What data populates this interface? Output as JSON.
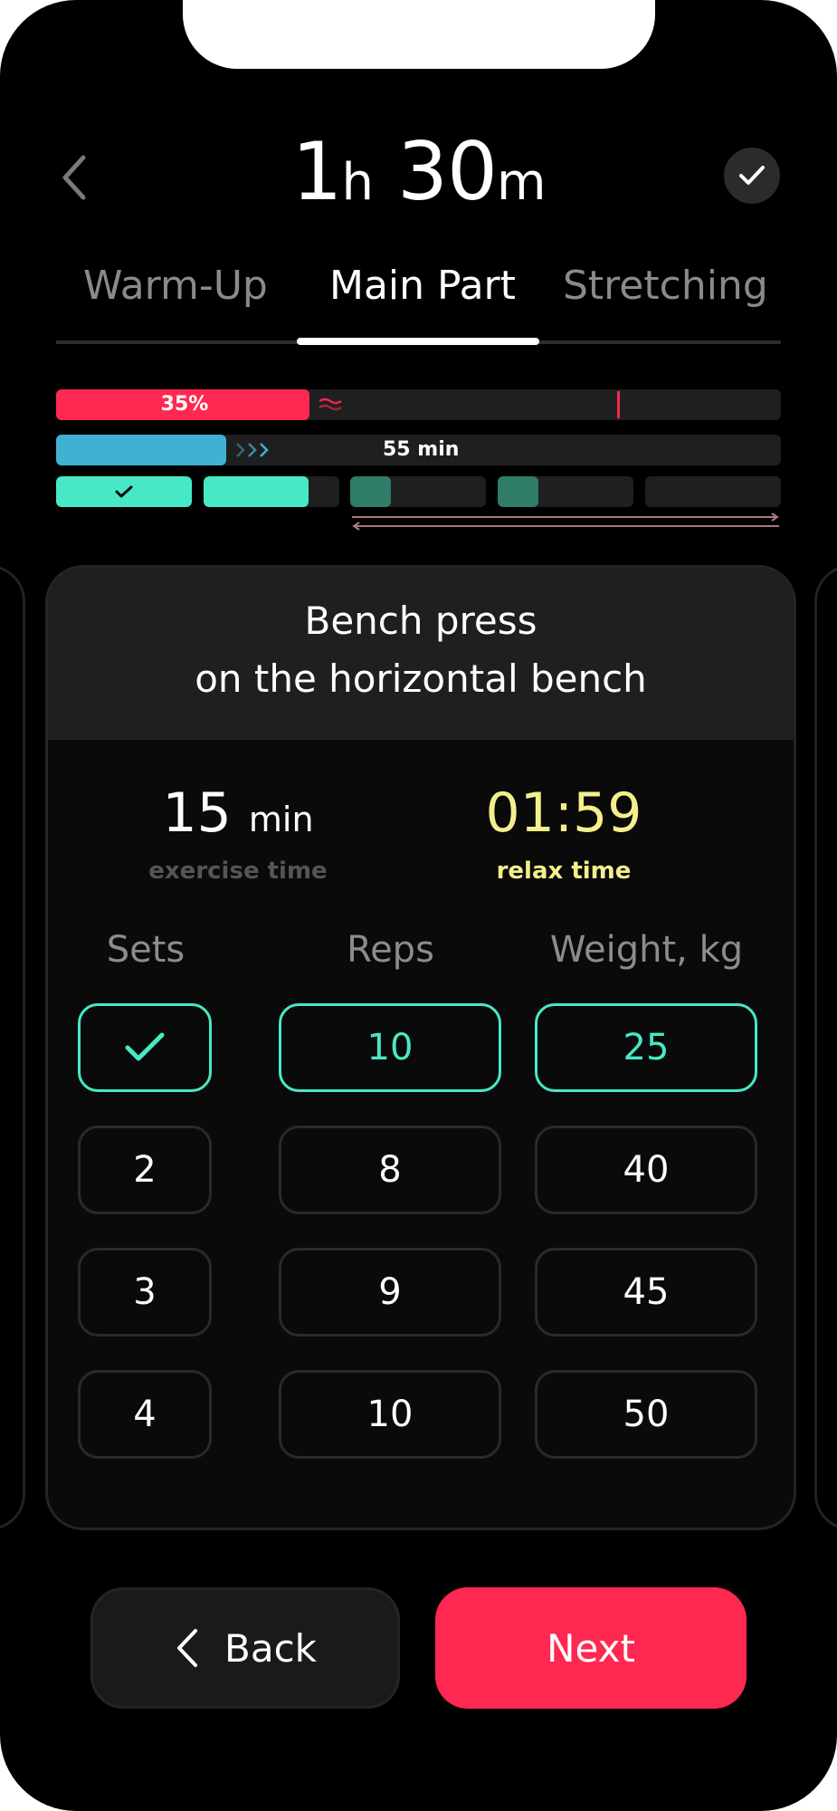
{
  "header": {
    "back_icon": "chevron-left-icon",
    "duration_hours": "1",
    "hours_unit": "h",
    "duration_minutes": "30",
    "minutes_unit": "m",
    "done_icon": "check-icon"
  },
  "tabs": [
    {
      "label": "Warm-Up",
      "active": false
    },
    {
      "label": "Main Part",
      "active": true
    },
    {
      "label": "Stretching",
      "active": false
    }
  ],
  "progress": {
    "overall_percent_label": "35%",
    "overall_fraction": 0.35,
    "bar_colors": {
      "red": "#ff2850",
      "blue": "#3fb2d4",
      "teal": "#47e8c6",
      "teal_dim": "#2f7c68"
    },
    "time_label": "55 min",
    "time_fraction": 0.235,
    "exercise_segments": [
      {
        "fill": 1.0,
        "done": true
      },
      {
        "fill": 0.77,
        "done": false
      },
      {
        "fill": 0.3,
        "done": false
      },
      {
        "fill": 0.3,
        "done": false
      },
      {
        "fill": 0,
        "done": false
      }
    ]
  },
  "exercise": {
    "title_line1": "Bench press",
    "title_line2": "on the horizontal bench",
    "exercise_time_value": "15",
    "exercise_time_unit": "min",
    "exercise_time_label": "exercise time",
    "relax_time_value": "01:59",
    "relax_time_label": "relax time",
    "relax_color": "#f4ef8c"
  },
  "table": {
    "headers": {
      "sets": "Sets",
      "reps": "Reps",
      "weight": "Weight, kg"
    },
    "rows": [
      {
        "set": "",
        "set_icon": "check-icon",
        "reps": "10",
        "weight": "25",
        "active": true
      },
      {
        "set": "2",
        "reps": "8",
        "weight": "40",
        "active": false
      },
      {
        "set": "3",
        "reps": "9",
        "weight": "45",
        "active": false
      },
      {
        "set": "4",
        "reps": "10",
        "weight": "50",
        "active": false
      }
    ]
  },
  "buttons": {
    "back_label": "Back",
    "back_icon": "chevron-left-icon",
    "next_label": "Next"
  }
}
